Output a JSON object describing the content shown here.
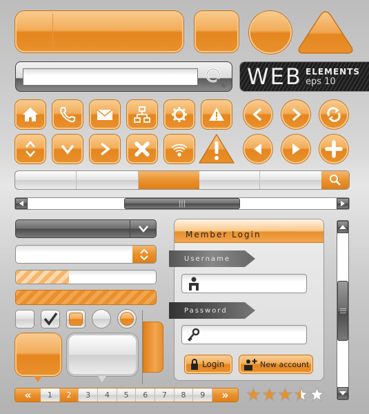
{
  "badge": {
    "title": "WEB",
    "subtitle": "ELEMENTS",
    "version": "eps 10"
  },
  "search": {
    "value": "",
    "placeholder": ""
  },
  "icons_row1": [
    "home-icon",
    "phone-icon",
    "mail-icon",
    "sitemap-icon",
    "gear-icon",
    "warning-icon",
    "chevron-left-icon",
    "chevron-right-icon",
    "refresh-icon"
  ],
  "icons_row2": [
    "up-down-icon",
    "chevron-down-icon",
    "chevron-right-icon",
    "close-icon",
    "wifi-icon",
    "warning-icon",
    "play-left-icon",
    "play-right-icon",
    "plus-icon"
  ],
  "progress": {
    "partial": 0.38,
    "full": 1.0
  },
  "checkbox_checked": true,
  "login": {
    "title": "Member Login",
    "username_label": "Username",
    "password_label": "Password",
    "username_value": "",
    "password_value": "",
    "login_button": "Login",
    "new_account_button": "New account"
  },
  "pagination": {
    "prev": "«",
    "next": "»",
    "pages": [
      "1",
      "2",
      "3",
      "4",
      "5",
      "6",
      "7",
      "8",
      "9"
    ],
    "current": "2"
  },
  "rating": {
    "value": 3.5,
    "max": 5
  },
  "colors": {
    "accent": "#e8902c",
    "dark": "#4a4a4a"
  }
}
